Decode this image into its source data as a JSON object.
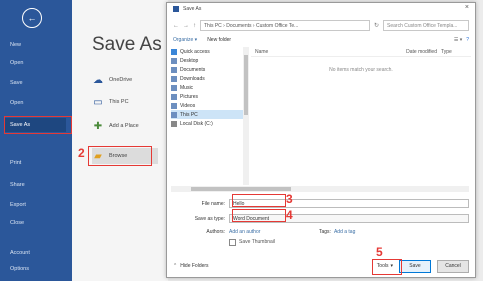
{
  "rail": {
    "items": [
      "New",
      "Open",
      "Save",
      "Save As",
      "Print",
      "Share",
      "Export",
      "Close",
      "Account",
      "Options"
    ],
    "active_index": 3
  },
  "backstage": {
    "title": "Save As",
    "locations": [
      "OneDrive",
      "This PC",
      "Add a Place",
      "Browse"
    ],
    "selected_location_index": 3
  },
  "dialog": {
    "title": "Save As",
    "close_glyph": "×",
    "nav": {
      "back": "←",
      "forward": "→",
      "up": "↑",
      "refresh": "↻"
    },
    "breadcrumb": "This PC › Documents › Custom Office Te...",
    "search_placeholder": "Search Custom Office Templa...",
    "commands": {
      "organize": "Organize ▾",
      "new_folder": "New folder",
      "view": "☰ ▾",
      "help": "?"
    },
    "tree": [
      "Quick access",
      "Desktop",
      "Documents",
      "Downloads",
      "Music",
      "Pictures",
      "Videos",
      "This PC",
      "Local Disk (C:)"
    ],
    "tree_active_index": 7,
    "columns": [
      "Name",
      "Date modified",
      "Type"
    ],
    "empty_message": "No items match your search.",
    "file_name_label": "File name:",
    "file_name_value": "Hello",
    "save_type_label": "Save as type:",
    "save_type_value": "Word Document",
    "authors_label": "Authors:",
    "authors_value": "Add an author",
    "tags_label": "Tags:",
    "tags_value": "Add a tag",
    "thumbnail_label": "Save Thumbnail",
    "hide_folders": "Hide Folders",
    "tools_label": "Tools",
    "save_label": "Save",
    "cancel_label": "Cancel"
  },
  "steps": {
    "one": "1",
    "two": "2",
    "three": "3",
    "four": "4",
    "five": "5"
  },
  "colors": {
    "accent": "#2b579a",
    "highlight": "#e53935"
  }
}
